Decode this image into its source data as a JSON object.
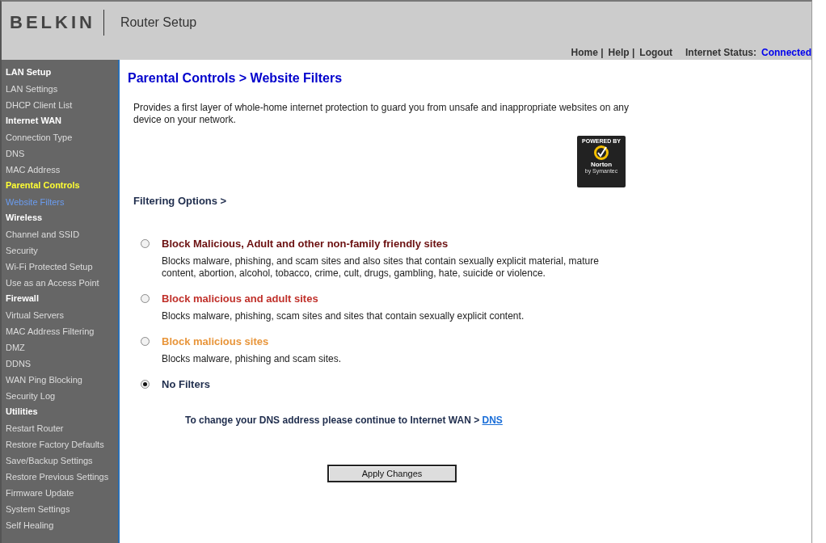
{
  "header": {
    "brand": "BELKIN",
    "title": "Router Setup",
    "links": [
      "Home |",
      "Help |",
      "Logout"
    ],
    "status_label": "Internet Status:",
    "status_value": "Connected"
  },
  "sidebar": {
    "sections": [
      {
        "label": "LAN Setup",
        "selected": false,
        "items": [
          {
            "label": "LAN Settings",
            "selected": false
          },
          {
            "label": "DHCP Client List",
            "selected": false
          }
        ]
      },
      {
        "label": "Internet WAN",
        "selected": false,
        "items": [
          {
            "label": "Connection Type",
            "selected": false
          },
          {
            "label": "DNS",
            "selected": false
          },
          {
            "label": "MAC Address",
            "selected": false
          }
        ]
      },
      {
        "label": "Parental Controls",
        "selected": true,
        "items": [
          {
            "label": "Website Filters",
            "selected": true
          }
        ]
      },
      {
        "label": "Wireless",
        "selected": false,
        "items": [
          {
            "label": "Channel and SSID",
            "selected": false
          },
          {
            "label": "Security",
            "selected": false
          },
          {
            "label": "Wi-Fi Protected Setup",
            "selected": false
          },
          {
            "label": "Use as an Access Point",
            "selected": false
          }
        ]
      },
      {
        "label": "Firewall",
        "selected": false,
        "items": [
          {
            "label": "Virtual Servers",
            "selected": false
          },
          {
            "label": "MAC Address Filtering",
            "selected": false
          },
          {
            "label": "DMZ",
            "selected": false
          },
          {
            "label": "DDNS",
            "selected": false
          },
          {
            "label": "WAN Ping Blocking",
            "selected": false
          },
          {
            "label": "Security Log",
            "selected": false
          }
        ]
      },
      {
        "label": "Utilities",
        "selected": false,
        "items": [
          {
            "label": "Restart Router",
            "selected": false
          },
          {
            "label": "Restore Factory Defaults",
            "selected": false
          },
          {
            "label": "Save/Backup Settings",
            "selected": false
          },
          {
            "label": "Restore Previous Settings",
            "selected": false
          },
          {
            "label": "Firmware Update",
            "selected": false
          },
          {
            "label": "System Settings",
            "selected": false
          },
          {
            "label": "Self Healing",
            "selected": false
          }
        ]
      }
    ]
  },
  "main": {
    "heading": "Parental Controls > Website Filters",
    "intro": "Provides a first layer of whole-home internet protection to guard you from unsafe and inappropriate websites on any device on your network.",
    "badge": {
      "top": "POWERED BY",
      "name": "Norton",
      "sub": "by Symantec"
    },
    "filtering_heading": "Filtering Options >",
    "options": [
      {
        "title": "Block Malicious, Adult and other non-family friendly sites",
        "color": "#6b1010",
        "description": "Blocks malware, phishing, and scam sites and also sites that contain sexually explicit material, mature content, abortion, alcohol, tobacco, crime, cult, drugs, gambling, hate, suicide or violence.",
        "selected": false
      },
      {
        "title": "Block malicious and adult sites",
        "color": "#c0302a",
        "description": "Blocks malware, phishing, scam sites and sites that contain sexually explicit content.",
        "selected": false
      },
      {
        "title": "Block malicious sites",
        "color": "#e8953a",
        "description": "Blocks malware, phishing and scam sites.",
        "selected": false
      },
      {
        "title": "No Filters",
        "color": "#1f2d4d",
        "selected": true
      }
    ],
    "dns_note": "To change your DNS address please continue to Internet WAN >",
    "dns_link": "DNS",
    "apply_button": "Apply Changes"
  }
}
